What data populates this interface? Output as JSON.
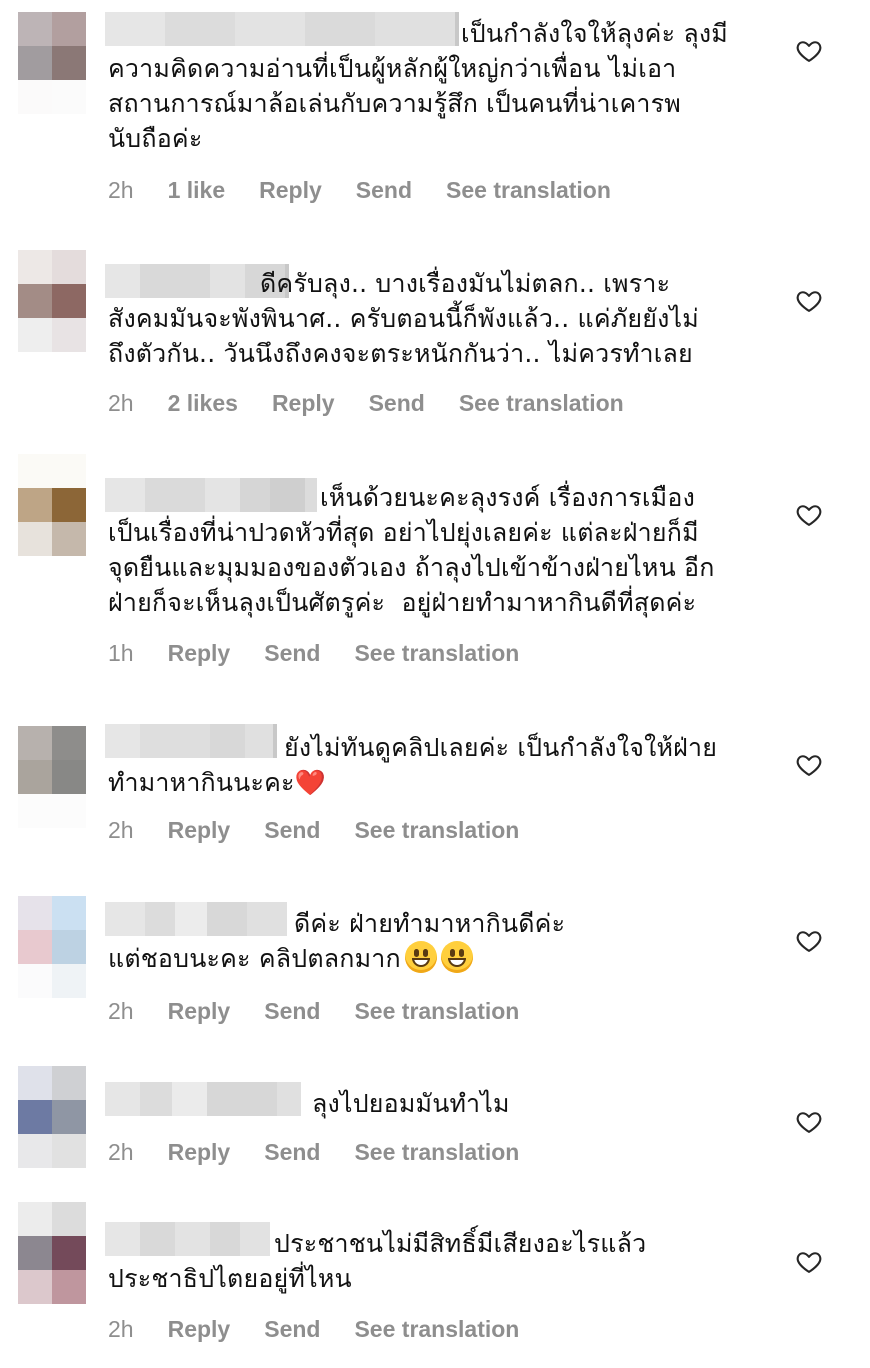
{
  "comments": [
    {
      "text": "เป็นกำลังใจให้ลุงค่ะ ลุงมี\nความคิดความอ่านที่เป็นผู้หลักผู้ใหญ่กว่าเพื่อน ไม่เอา\nสถานการณ์มาล้อเล่นกับความรู้สึก เป็นคนที่น่าเคารพ\nนับถือค่ะ",
      "time": "2h",
      "likes": "1 like",
      "reply": "Reply",
      "send": "Send",
      "translate": "See translation"
    },
    {
      "text": "ดีครับลุง.. บางเรื่องมันไม่ตลก.. เพราะ\nสังคมมันจะพังพินาศ.. ครับตอนนี้ก็พังแล้ว.. แค่ภัยยังไม่\nถึงตัวกัน.. วันนึงถึงคงจะตระหนักกันว่า.. ไม่ควรทำเลย",
      "time": "2h",
      "likes": "2 likes",
      "reply": "Reply",
      "send": "Send",
      "translate": "See translation"
    },
    {
      "text": "เห็นด้วยนะคะลุงรงค์ เรื่องการเมือง\nเป็นเรื่องที่น่าปวดหัวที่สุด อย่าไปยุ่งเลยค่ะ แต่ละฝ่ายก็มี\nจุดยืนและมุมมองของตัวเอง ถ้าลุงไปเข้าข้างฝ่ายไหน อีก\nฝ่ายก็จะเห็นลุงเป็นศัตรูค่ะ  อยู่ฝ่ายทำมาหากินดีที่สุดค่ะ",
      "time": "1h",
      "reply": "Reply",
      "send": "Send",
      "translate": "See translation"
    },
    {
      "text": "ยังไม่ทันดูคลิปเลยค่ะ เป็นกำลังใจให้ฝ่าย\nทำมาหากินนะคะ",
      "emoji": "❤️",
      "time": "2h",
      "reply": "Reply",
      "send": "Send",
      "translate": "See translation"
    },
    {
      "text": "ดีค่ะ ฝ่ายทำมาหากินดีค่ะ\nแต่ชอบนะคะ คลิปตลกมาก",
      "emoji_name": "grinning-face-emoji",
      "time": "2h",
      "reply": "Reply",
      "send": "Send",
      "translate": "See translation"
    },
    {
      "text": "ลุงไปยอมมันทำไม",
      "time": "2h",
      "reply": "Reply",
      "send": "Send",
      "translate": "See translation"
    },
    {
      "text": "ประชาชนไม่มีสิทธิ์มีเสียงอะไรแล้ว\nประชาธิปไตยอยู่ที่ไหน",
      "time": "2h",
      "reply": "Reply",
      "send": "Send",
      "translate": "See translation"
    }
  ],
  "colors": {
    "meta_text": "#8e8e8e",
    "body_text": "#111111",
    "heart_outline": "#262626",
    "emoji_heart": "#e3141a"
  },
  "icons": {
    "like": "heart-outline-icon"
  }
}
